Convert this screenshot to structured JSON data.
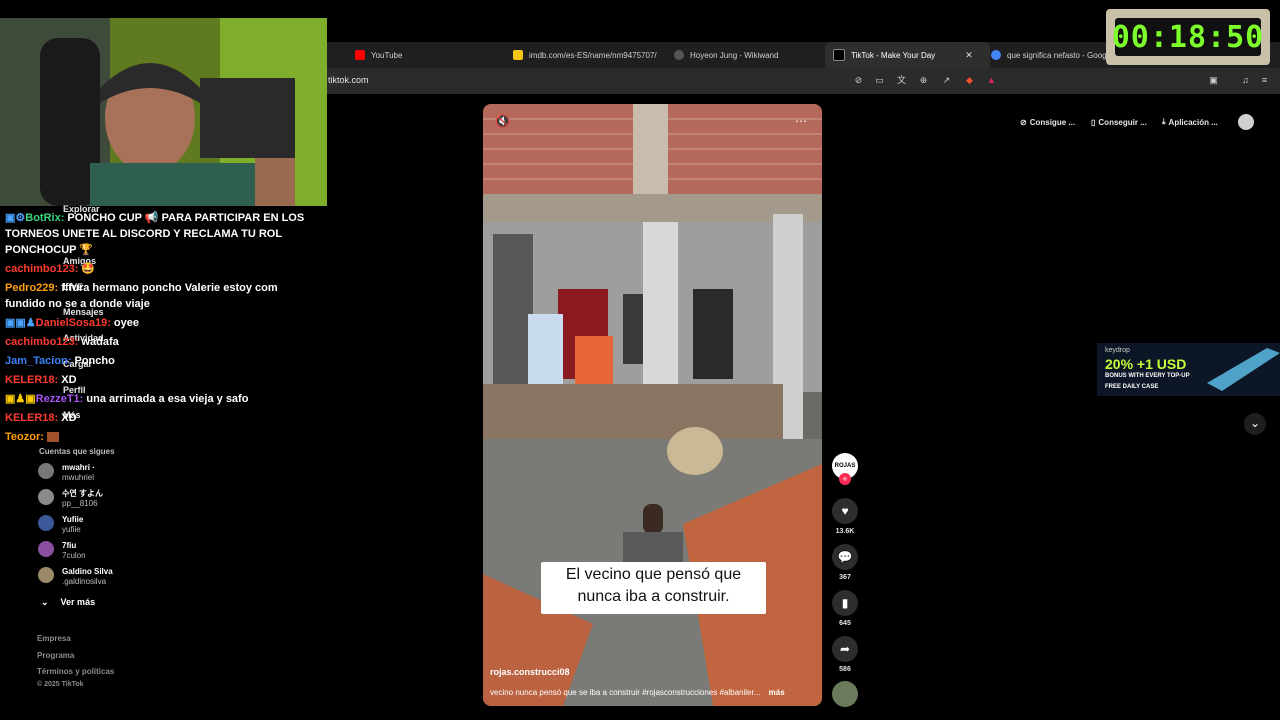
{
  "browser": {
    "tabs": [
      {
        "label": "YouTube",
        "color": "#ff0000"
      },
      {
        "label": "imdb.com/es-ES/name/nm9475707/",
        "color": "#f5c518"
      },
      {
        "label": "Hoyeon Jung - Wikiwand",
        "color": "#888888"
      },
      {
        "label": "TikTok - Make Your Day",
        "color": "#ffffff"
      },
      {
        "label": "que significa nefasto - Googl",
        "color": "#4285f4"
      }
    ],
    "url": "tiktok.com"
  },
  "timer": "00:18:50",
  "chat": [
    {
      "user": "BotRix:",
      "user_color": "#37d67a",
      "text": " PONCHO CUP 📢 PARA PARTICIPAR EN LOS TORNEOS UNETE AL DISCORD Y RECLAMA TU ROL PONCHOCUP 🏆"
    },
    {
      "user": "cachimbo123:",
      "user_color": "#ff3b30",
      "text": " 🤩"
    },
    {
      "user": "Pedro229:",
      "user_color": "#ff9f0a",
      "text": " fffura hermano poncho Valerie estoy com fundido no se a donde viaje"
    },
    {
      "user": "DanielSosa19:",
      "user_color": "#ff3b30",
      "text": " oyee"
    },
    {
      "user": "cachimbo123:",
      "user_color": "#ff3b30",
      "text": " wadafa"
    },
    {
      "user": "Jam_Tacion:",
      "user_color": "#3b82f6",
      "text": " Poncho"
    },
    {
      "user": "KELER18:",
      "user_color": "#ff3b30",
      "text": " XD"
    },
    {
      "user": "RezzeT1:",
      "user_color": "#a855f7",
      "text": " una arrimada a esa vieja y safo"
    },
    {
      "user": "KELER18:",
      "user_color": "#ff3b30",
      "text": " XD"
    },
    {
      "user": "Teozor:",
      "user_color": "#ff9f0a",
      "text": " "
    }
  ],
  "sidebar": {
    "nav": [
      "Explorar",
      "Amigos",
      "LIVE",
      "Mensajes",
      "Actividad",
      "Cargar",
      "Perfil",
      "Más"
    ],
    "following_title": "Cuentas que sigues",
    "following": [
      {
        "name": "mwahri ·",
        "handle": "mwuhriel",
        "color": "#777777"
      },
      {
        "name": "수연 すよん",
        "handle": "pp__8106",
        "color": "#8a8a8a"
      },
      {
        "name": "Yufiie",
        "handle": "yufiie",
        "color": "#3b5998"
      },
      {
        "name": "7fiu",
        "handle": "7culon",
        "color": "#8a4f9e"
      },
      {
        "name": "Galdino Silva",
        "handle": ".galdinosilva",
        "color": "#9a8a6a"
      }
    ],
    "see_more": "Ver más",
    "footer": [
      "Empresa",
      "Programa",
      "Términos y políticas",
      "© 2025 TikTok"
    ]
  },
  "video": {
    "caption_line1": "El vecino que pensó que",
    "caption_line2": "nunca iba a construir.",
    "author": "rojas.construcci08",
    "description": "vecino  nunca  pensó que se iba a construir #rojasconstrucciones #albaniler...",
    "more": "más",
    "avatar_text": "ROJAS"
  },
  "actions": {
    "likes": "13.6K",
    "comments": "367",
    "saves": "645",
    "shares": "586"
  },
  "top_buttons": [
    "Consigue ...",
    "Conseguir ...",
    "Aplicación ..."
  ],
  "ad": {
    "brand": "keydrop",
    "headline": "20% +1 USD",
    "sub": "BONUS WITH EVERY TOP-UP",
    "cta": "FREE DAILY CASE"
  }
}
